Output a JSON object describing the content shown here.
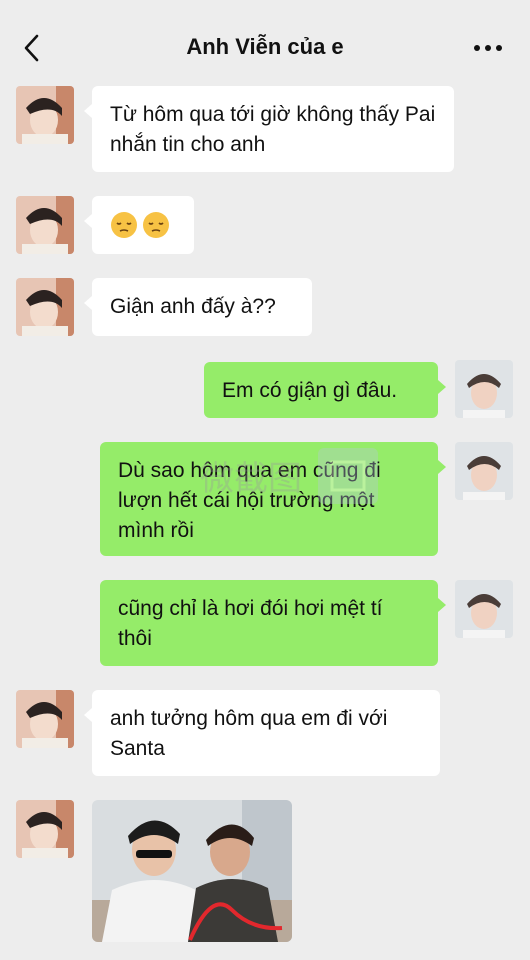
{
  "header": {
    "title": "Anh Viễn của e",
    "back_icon": "chevron-left-icon",
    "more_icon": "more-dots-icon"
  },
  "messages": [
    {
      "side": "left",
      "text": "Từ hôm qua tới giờ không thấy Pai nhắn tin cho anh"
    },
    {
      "side": "left",
      "emoji": [
        "pensive-face",
        "pensive-face"
      ]
    },
    {
      "side": "left",
      "text": "Giận anh đấy à??"
    },
    {
      "side": "right",
      "text": "Em có giận gì đâu."
    },
    {
      "side": "right",
      "text": "Dù sao hôm qua em cũng đi lượn hết cái hội trường một mình rồi"
    },
    {
      "side": "right",
      "text": "cũng chỉ là hơi đói hơi mệt tí thôi"
    },
    {
      "side": "left",
      "text": "anh tưởng hôm qua em đi với Santa"
    },
    {
      "side": "left",
      "image": "photo-two-people"
    }
  ],
  "colors": {
    "background": "#ededed",
    "sent_bubble": "#95ec69",
    "received_bubble": "#ffffff"
  },
  "watermark": "微截图"
}
